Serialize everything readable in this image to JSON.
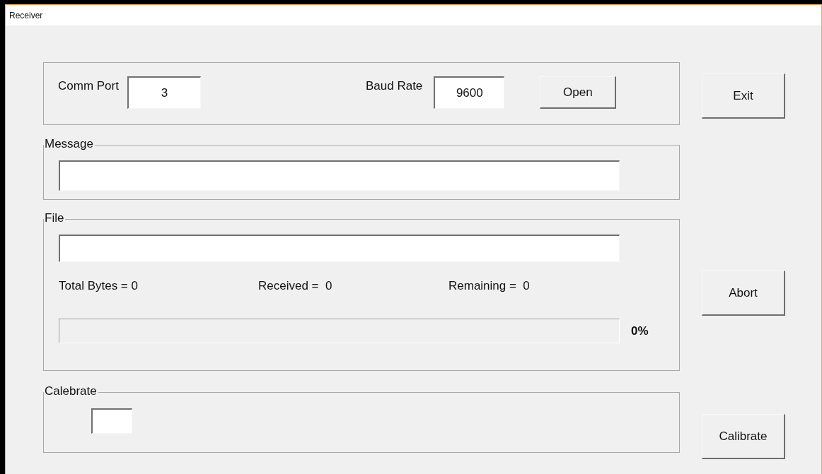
{
  "window": {
    "title": "Receiver"
  },
  "port_group": {
    "comm_port": {
      "label": "Comm Port",
      "value": "3"
    },
    "baud_rate": {
      "label": "Baud Rate",
      "value": "9600"
    },
    "open_button": "Open"
  },
  "message_group": {
    "legend": "Message"
  },
  "file_group": {
    "legend": "File",
    "stats": [
      "Total Bytes = 0",
      "Received =  0",
      "Remaining =  0"
    ],
    "progress": {
      "level": 0,
      "reading": "0%"
    }
  },
  "calibrate_group": {
    "legend": "Calebrate"
  },
  "buttons": [
    "Exit",
    "Abort",
    "Calibrate"
  ]
}
